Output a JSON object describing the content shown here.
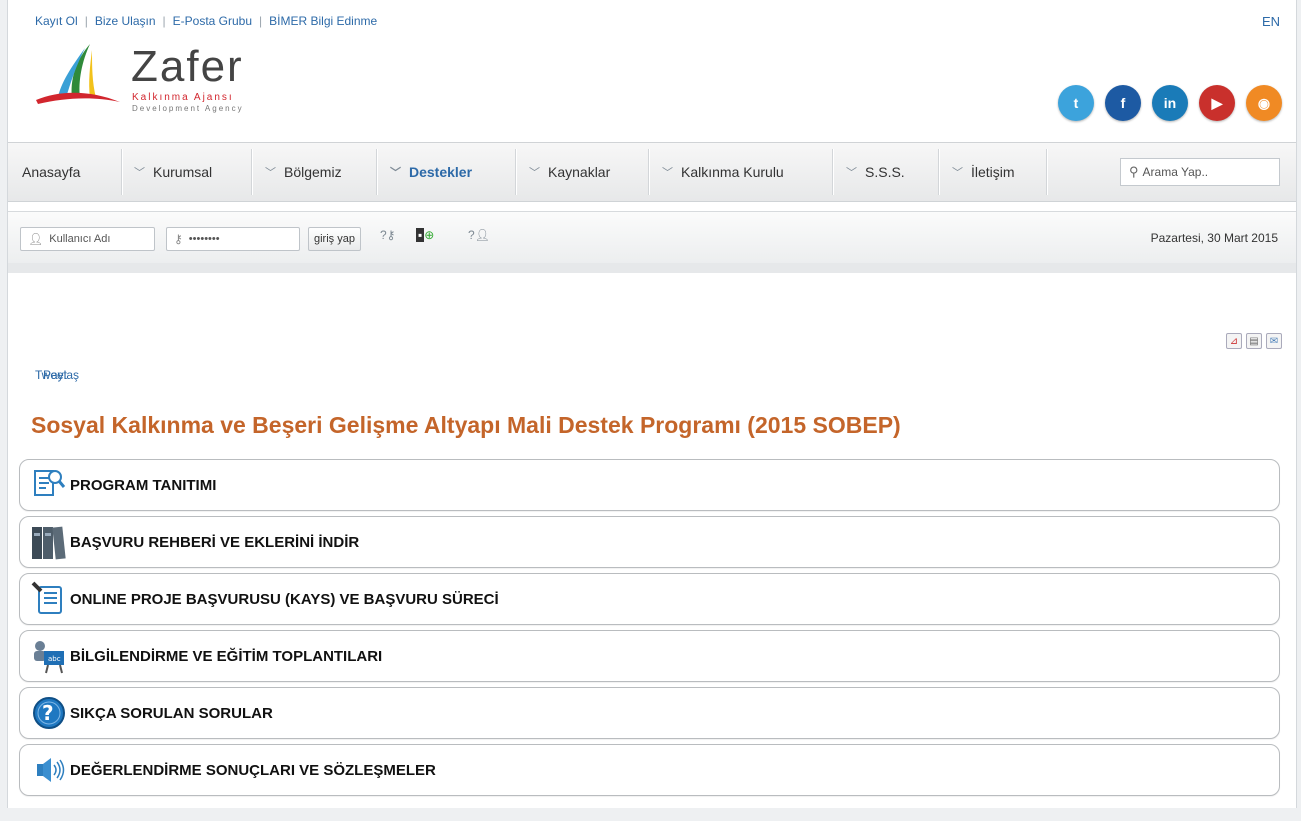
{
  "top_links": [
    "Kayıt Ol",
    "Bize Ulaşın",
    "E-Posta Grubu",
    "BİMER Bilgi Edinme"
  ],
  "lang": "EN",
  "logo": {
    "title": "Zafer",
    "sub1": "Kalkınma Ajansı",
    "sub2": "Development Agency"
  },
  "social": [
    {
      "icon": "twitter-icon",
      "glyph": "t",
      "color": "#3ca3dc"
    },
    {
      "icon": "facebook-icon",
      "glyph": "f",
      "color": "#1d5aa3"
    },
    {
      "icon": "linkedin-icon",
      "glyph": "in",
      "color": "#1a7bb8"
    },
    {
      "icon": "youtube-icon",
      "glyph": "▶",
      "color": "#c9302c"
    },
    {
      "icon": "rss-icon",
      "glyph": "◉",
      "color": "#f08a24"
    }
  ],
  "nav": {
    "items": [
      "Anasayfa",
      "Kurumsal",
      "Bölgemiz",
      "Destekler",
      "Kaynaklar",
      "Kalkınma Kurulu",
      "S.S.S.",
      "İletişim"
    ],
    "active": "Destekler",
    "search_placeholder": "Arama Yap.."
  },
  "login": {
    "username_placeholder": "Kullanıcı Adı",
    "password_value": "••••••••",
    "login_button": "giriş yap",
    "date": "Pazartesi, 30 Mart 2015"
  },
  "share": {
    "twitter": "Tweet",
    "paylas": "Paylaş"
  },
  "page_title": "Sosyal Kalkınma ve Beşeri Gelişme Altyapı Mali Destek Programı (2015 SOBEP)",
  "sections": [
    {
      "label": "PROGRAM TANITIMI",
      "icon": "document-search-icon"
    },
    {
      "label": "BAŞVURU REHBERİ VE EKLERİNİ İNDİR",
      "icon": "books-icon"
    },
    {
      "label": "ONLINE PROJE BAŞVURUSU (KAYS) VE BAŞVURU SÜRECİ",
      "icon": "online-form-icon"
    },
    {
      "label": "BİLGİLENDİRME VE EĞİTİM TOPLANTILARI",
      "icon": "training-board-icon"
    },
    {
      "label": "SIKÇA SORULAN SORULAR",
      "icon": "question-icon"
    },
    {
      "label": "DEĞERLENDİRME SONUÇLARI VE SÖZLEŞMELER",
      "icon": "speaker-icon"
    }
  ]
}
